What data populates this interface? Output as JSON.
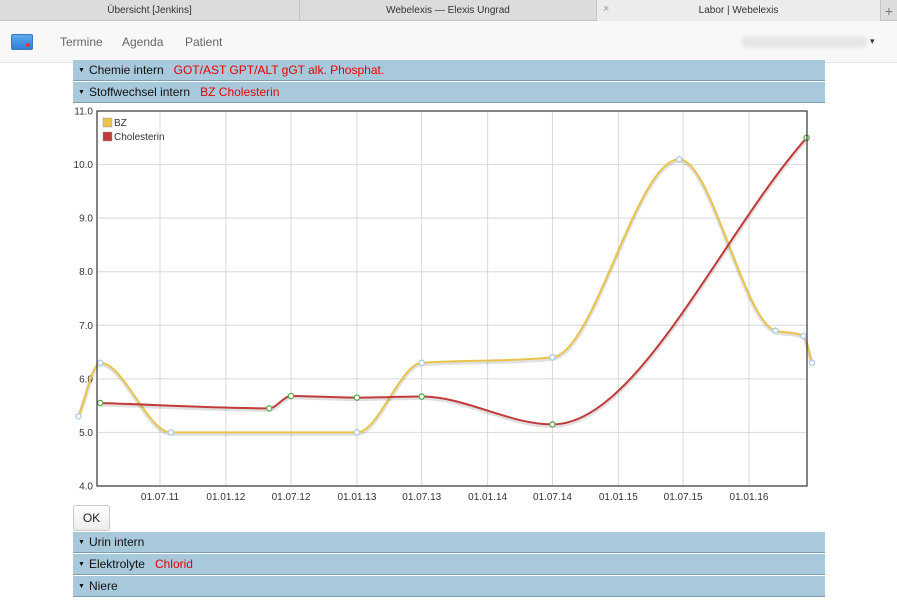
{
  "browser": {
    "tabs": [
      {
        "label": "Übersicht [Jenkins]"
      },
      {
        "label": "Webelexis — Elexis Ungrad"
      },
      {
        "label": "Labor | Webelexis",
        "close": "×"
      }
    ],
    "new_tab": "+"
  },
  "navbar": {
    "links": [
      "Termine",
      "Agenda",
      "Patient"
    ],
    "user_caret": "▾"
  },
  "sections": {
    "chemie": {
      "label": "Chemie intern",
      "tags": "GOT/AST GPT/ALT gGT alk. Phosphat."
    },
    "stoffwechsel": {
      "label": "Stoffwechsel intern",
      "tags": "BZ Cholesterin"
    },
    "urin": {
      "label": "Urin intern",
      "tags": ""
    },
    "elektrolyte": {
      "label": "Elektrolyte",
      "tags": "Chlorid"
    },
    "niere": {
      "label": "Niere",
      "tags": ""
    }
  },
  "caret": "▼",
  "ok_label": "OK",
  "chart_data": {
    "type": "line",
    "xlabel": "",
    "ylabel": "",
    "ylim": [
      4.0,
      11.0
    ],
    "yticks": [
      "4.0",
      "5.0",
      "6.0",
      "7.0",
      "8.0",
      "9.0",
      "10.0",
      "11.0"
    ],
    "xticks": [
      "01.07.11",
      "01.01.12",
      "01.07.12",
      "01.01.13",
      "01.07.13",
      "01.01.14",
      "01.07.14",
      "01.01.15",
      "01.07.15",
      "01.01.16"
    ],
    "legend_position": "top-left",
    "grid": true,
    "series": [
      {
        "name": "BZ",
        "color": "#e8c44a",
        "marker_color": "#a9cbe8",
        "x": [
          "2010-11-15",
          "2011-01-15",
          "2011-08-01",
          "2013-01-01",
          "2013-07-01",
          "2014-07-01",
          "2015-06-20",
          "2016-03-15",
          "2016-06-01",
          "2016-06-25"
        ],
        "values": [
          5.3,
          6.3,
          5.0,
          5.0,
          6.3,
          6.4,
          10.1,
          6.9,
          6.8,
          6.3
        ]
      },
      {
        "name": "Cholesterin",
        "color": "#c23b3b",
        "marker_color": "#5aa84a",
        "x": [
          "2011-01-15",
          "2012-05-01",
          "2012-07-01",
          "2013-01-01",
          "2013-07-01",
          "2014-07-01",
          "2016-06-10"
        ],
        "values": [
          5.55,
          5.45,
          5.68,
          5.65,
          5.67,
          5.15,
          10.5
        ]
      }
    ]
  }
}
